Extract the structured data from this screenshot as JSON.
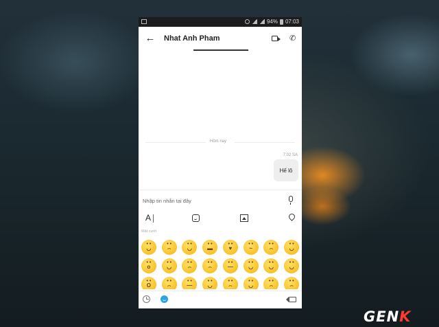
{
  "status_bar": {
    "battery": "94%",
    "time": "07:03"
  },
  "header": {
    "contact_name": "Nhat Anh Pham"
  },
  "chat": {
    "date_divider": "Hôm nay",
    "messages": [
      {
        "time": "7:02 SA",
        "text": "Hế lô"
      }
    ]
  },
  "composer": {
    "placeholder": "Nhập tin nhắn tại đây"
  },
  "toolbar": {
    "text_format_label": "A"
  },
  "emoji_panel": {
    "section_label": "Mặt cười",
    "emojis": [
      "smile",
      "worried",
      "grin",
      "sunglasses",
      "heart-eyes",
      "sneeze",
      "sad",
      "rofl",
      "surprised",
      "wink",
      "cry",
      "sweat",
      "neutral",
      "smirk",
      "blush",
      "devil-cat",
      "shocked",
      "squint",
      "sleepy",
      "relieved",
      "pensive",
      "tongue",
      "angry",
      "frown"
    ]
  },
  "watermark": {
    "brand": "GENK"
  },
  "colors": {
    "accent": "#2ba4e2",
    "emoji_yellow": "#f5b50f"
  }
}
